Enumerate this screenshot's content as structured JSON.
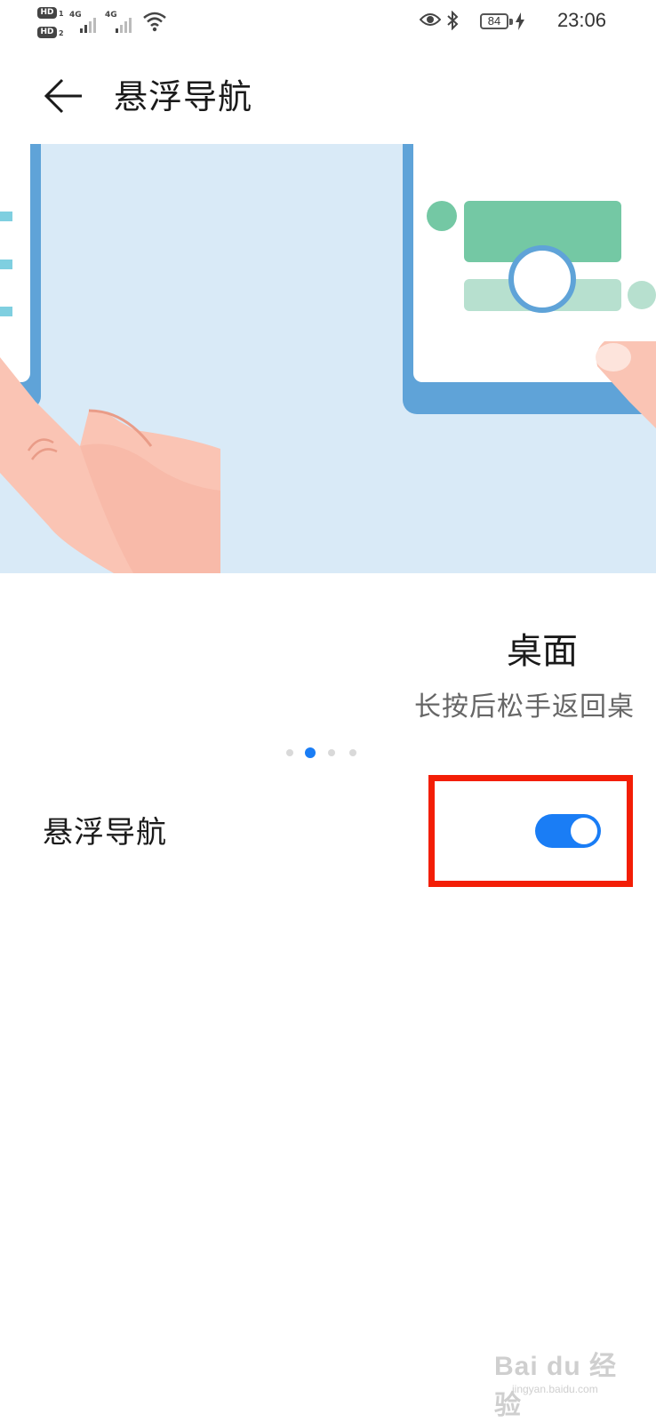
{
  "status_bar": {
    "hd1": "HD",
    "hd1_sub": "1",
    "hd2": "HD",
    "hd2_sub": "2",
    "network1": "4G",
    "network2": "4G",
    "battery": "84",
    "time": "23:06",
    "icons": [
      "signal-icon",
      "wifi-icon",
      "eye-icon",
      "bluetooth-icon",
      "battery-icon",
      "charging-icon"
    ]
  },
  "header": {
    "back_icon": "arrow-left-icon",
    "title": "悬浮导航"
  },
  "carousel": {
    "slide_title": "桌面",
    "slide_description": "长按后松手返回桌",
    "page_count": 4,
    "active_index": 1
  },
  "setting": {
    "label": "悬浮导航",
    "toggle_on": true
  },
  "watermark": {
    "logo": "Bai du 经验",
    "sub": "jingyan.baidu.com"
  },
  "colors": {
    "accent": "#1a7df5",
    "highlight": "#f31e06",
    "banner_bg": "#d9eaf7",
    "phone_frame": "#5fa3d8",
    "skin": "#fac4b4",
    "green": "#74c8a4"
  }
}
